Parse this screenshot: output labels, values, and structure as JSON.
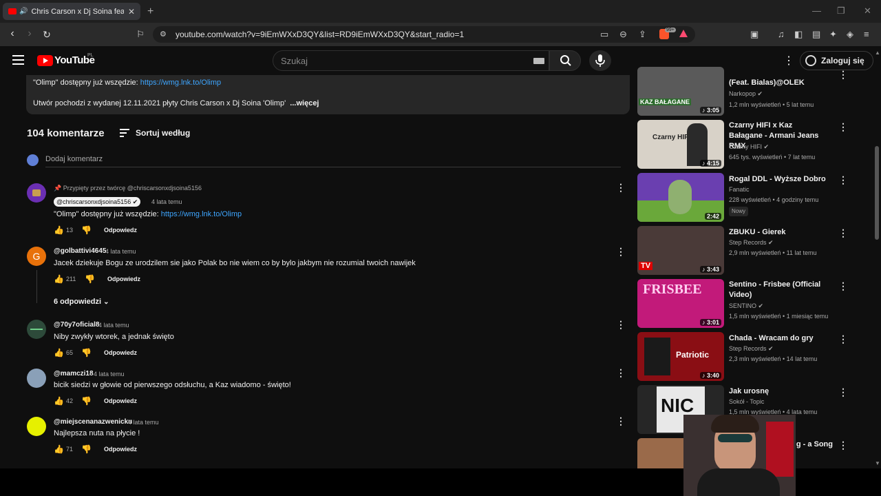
{
  "browser": {
    "tab_title": "Chris Carson x Dj Soina feat. K",
    "url": "youtube.com/watch?v=9iEmWXxD3QY&list=RD9iEmWXxD3QY&start_radio=1",
    "ext_badge": "99+"
  },
  "header": {
    "logo_text": "YouTube",
    "region": "PL",
    "search_placeholder": "Szukaj",
    "login_label": "Zaloguj się"
  },
  "description": {
    "line1_prefix": "\"Olimp\" dostępny już wszędzie: ",
    "line1_link": "https://wmg.lnk.to/Olimp",
    "line2": "Utwór pochodzi z wydanej 12.11.2021 płyty Chris Carson x Dj Soina 'Olimp'",
    "more": "...więcej"
  },
  "comments_header": {
    "count_label": "104 komentarze",
    "sort_label": "Sortuj według",
    "add_placeholder": "Dodaj komentarz"
  },
  "comments": [
    {
      "pinned_label": "Przypięty przez twórcę @chriscarsonxdjsoina5156",
      "author": "@chriscarsonxdjsoina5156",
      "time": "4 lata temu",
      "text_prefix": "\"Olimp\" dostępny już wszędzie: ",
      "text_link": "https://wmg.lnk.to/Olimp",
      "likes": "13",
      "reply_label": "Odpowiedz",
      "avatar_color": "#6b2fb3"
    },
    {
      "author": "@golbattivi4645",
      "time": "4 lata temu",
      "text": "Jacek dziekuje Bogu ze urodzilem sie jako Polak bo nie wiem co by bylo jakbym nie rozumial twoich nawijek",
      "likes": "211",
      "reply_label": "Odpowiedz",
      "avatar_letter": "G",
      "avatar_color": "#e8710a",
      "replies_label": "6 odpowiedzi"
    },
    {
      "author": "@70y7oficial8",
      "time": "4 lata temu",
      "text": "Niby zwykły wtorek, a jednak święto",
      "likes": "65",
      "reply_label": "Odpowiedz",
      "avatar_color": "#2d4a3a"
    },
    {
      "author": "@mamczi18",
      "time": "4 lata temu",
      "text": "bicik siedzi w głowie od pierwszego odsłuchu, a Kaz wiadomo - święto!",
      "likes": "42",
      "reply_label": "Odpowiedz",
      "avatar_color": "#8aa0b8"
    },
    {
      "author": "@miejscenanazwenicku",
      "time": "4 lata temu",
      "text": "Najlepsza nuta na płycie !",
      "likes": "71",
      "reply_label": "Odpowiedz",
      "avatar_color": "#e6f000"
    }
  ],
  "sidebar": [
    {
      "title": "(Feat. Bialas)@OLEK",
      "channel": "Narkopop",
      "verified": true,
      "meta": "1,2 mln wyświetleń • 5 lat temu",
      "duration": "3:05",
      "music": true,
      "thumb_color": "#5a5a5a",
      "thumb_text": "KAZ BAŁAGANE"
    },
    {
      "title": "Czarny HIFI x Kaz Bałagane - Armani Jeans RMX",
      "channel": "Czarny HIFI",
      "verified": true,
      "meta": "645 tys. wyświetleń • 7 lat temu",
      "duration": "4:15",
      "music": true,
      "thumb_color": "#d8d2c8",
      "thumb_text": "Czarny HIFI"
    },
    {
      "title": "Rogal DDL - Wyższe Dobro",
      "channel": "Fanatic",
      "verified": false,
      "meta": "228 wyświetleń • 4 godziny temu",
      "badge": "Nowy",
      "duration": "2:42",
      "music": false,
      "thumb_color": "#6a3fb0",
      "thumb_text": ""
    },
    {
      "title": "ZBUKU - Gierek",
      "channel": "Step Records",
      "verified": true,
      "meta": "2,9 mln wyświetleń • 11 lat temu",
      "duration": "3:43",
      "music": true,
      "thumb_color": "#4a3a38",
      "thumb_text": "TV"
    },
    {
      "title": "Sentino - Frisbee (Official Video)",
      "channel": "SENTINO",
      "verified": true,
      "meta": "1,5 mln wyświetleń • 1 miesiąc temu",
      "duration": "3:01",
      "music": true,
      "thumb_color": "#c21a7a",
      "thumb_text": "FRISBEE"
    },
    {
      "title": "Chada - Wracam do gry",
      "channel": "Step Records",
      "verified": true,
      "meta": "2,3 mln wyświetleń • 14 lat temu",
      "duration": "3:40",
      "music": true,
      "thumb_color": "#8a0e14",
      "thumb_text": "Patriotic"
    },
    {
      "title": "Jak urosnę",
      "channel": "Sokół - Topic",
      "verified": false,
      "meta": "1,5 mln wyświetleń • 4 lata temu",
      "duration": "",
      "music": false,
      "thumb_color": "#e8e8e8",
      "thumb_text": "NIC"
    },
    {
      "title": "g - a Song",
      "channel": "",
      "verified": false,
      "meta": "",
      "duration": "",
      "music": false,
      "thumb_color": "#9a6a4a",
      "thumb_text": ""
    }
  ]
}
